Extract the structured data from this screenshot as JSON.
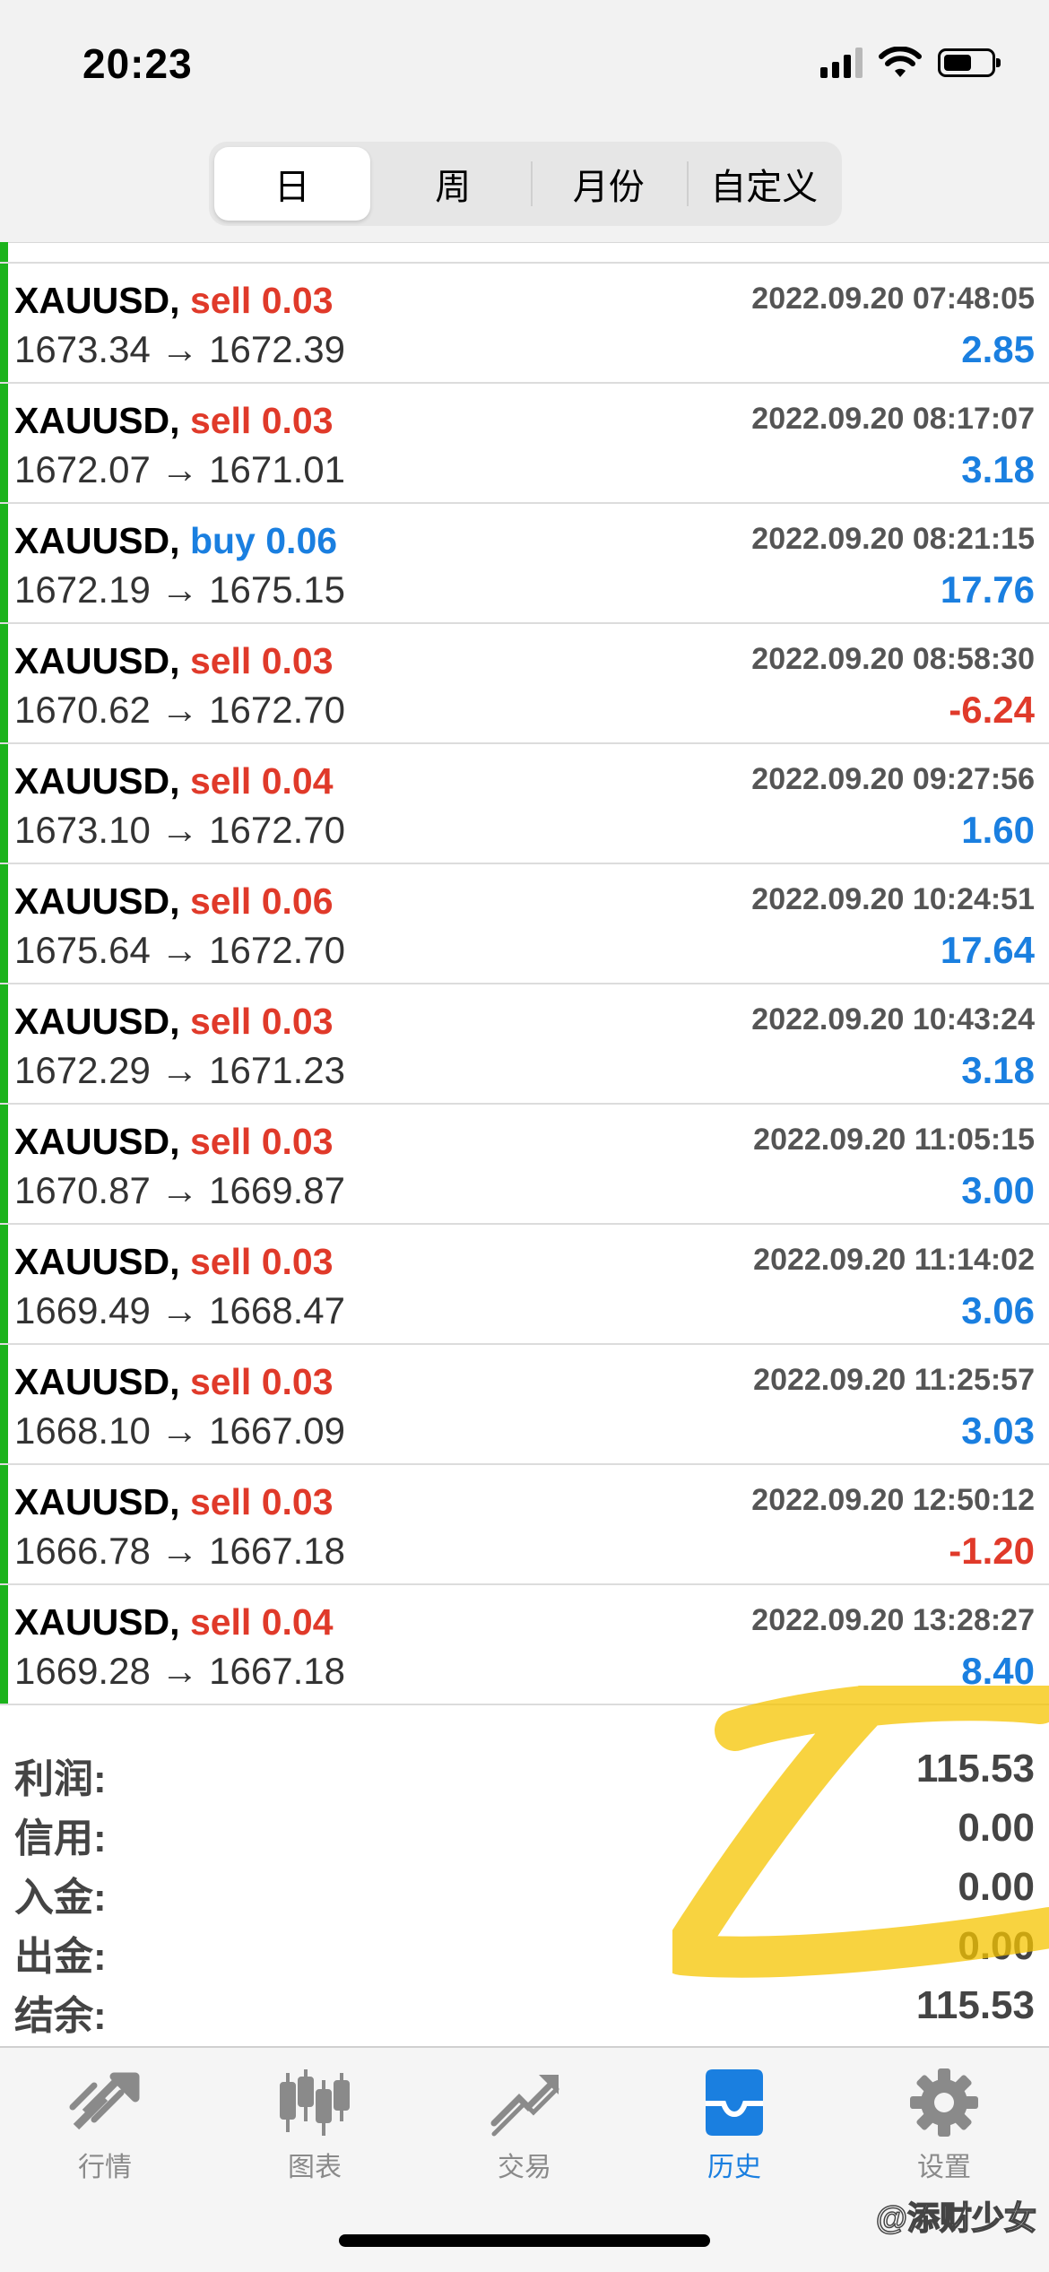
{
  "status_bar": {
    "time": "20:23"
  },
  "segments": [
    "日",
    "周",
    "月份",
    "自定义"
  ],
  "active_segment": "日",
  "deals": [
    {
      "symbol": "XAUUSD,",
      "side": "sell",
      "volume": "0.03",
      "time": "2022.09.20 07:48:05",
      "prices": "1673.34 → 1672.39",
      "profit": "2.85",
      "sign": "pos"
    },
    {
      "symbol": "XAUUSD,",
      "side": "sell",
      "volume": "0.03",
      "time": "2022.09.20 08:17:07",
      "prices": "1672.07 → 1671.01",
      "profit": "3.18",
      "sign": "pos"
    },
    {
      "symbol": "XAUUSD,",
      "side": "buy",
      "volume": "0.06",
      "time": "2022.09.20 08:21:15",
      "prices": "1672.19 → 1675.15",
      "profit": "17.76",
      "sign": "pos"
    },
    {
      "symbol": "XAUUSD,",
      "side": "sell",
      "volume": "0.03",
      "time": "2022.09.20 08:58:30",
      "prices": "1670.62 → 1672.70",
      "profit": "-6.24",
      "sign": "neg"
    },
    {
      "symbol": "XAUUSD,",
      "side": "sell",
      "volume": "0.04",
      "time": "2022.09.20 09:27:56",
      "prices": "1673.10 → 1672.70",
      "profit": "1.60",
      "sign": "pos"
    },
    {
      "symbol": "XAUUSD,",
      "side": "sell",
      "volume": "0.06",
      "time": "2022.09.20 10:24:51",
      "prices": "1675.64 → 1672.70",
      "profit": "17.64",
      "sign": "pos"
    },
    {
      "symbol": "XAUUSD,",
      "side": "sell",
      "volume": "0.03",
      "time": "2022.09.20 10:43:24",
      "prices": "1672.29 → 1671.23",
      "profit": "3.18",
      "sign": "pos"
    },
    {
      "symbol": "XAUUSD,",
      "side": "sell",
      "volume": "0.03",
      "time": "2022.09.20 11:05:15",
      "prices": "1670.87 → 1669.87",
      "profit": "3.00",
      "sign": "pos"
    },
    {
      "symbol": "XAUUSD,",
      "side": "sell",
      "volume": "0.03",
      "time": "2022.09.20 11:14:02",
      "prices": "1669.49 → 1668.47",
      "profit": "3.06",
      "sign": "pos"
    },
    {
      "symbol": "XAUUSD,",
      "side": "sell",
      "volume": "0.03",
      "time": "2022.09.20 11:25:57",
      "prices": "1668.10 → 1667.09",
      "profit": "3.03",
      "sign": "pos"
    },
    {
      "symbol": "XAUUSD,",
      "side": "sell",
      "volume": "0.03",
      "time": "2022.09.20 12:50:12",
      "prices": "1666.78 → 1667.18",
      "profit": "-1.20",
      "sign": "neg"
    },
    {
      "symbol": "XAUUSD,",
      "side": "sell",
      "volume": "0.04",
      "time": "2022.09.20 13:28:27",
      "prices": "1669.28 → 1667.18",
      "profit": "8.40",
      "sign": "pos"
    }
  ],
  "summary": [
    {
      "label": "利润:",
      "value": "115.53"
    },
    {
      "label": "信用:",
      "value": "0.00"
    },
    {
      "label": "入金:",
      "value": "0.00"
    },
    {
      "label": "出金:",
      "value": "0.00"
    },
    {
      "label": "结余:",
      "value": "115.53"
    }
  ],
  "tabs": [
    {
      "label": "行情",
      "icon": "quotes-icon"
    },
    {
      "label": "图表",
      "icon": "chart-icon"
    },
    {
      "label": "交易",
      "icon": "trade-icon"
    },
    {
      "label": "历史",
      "icon": "history-icon"
    },
    {
      "label": "设置",
      "icon": "settings-icon"
    }
  ],
  "active_tab": "历史",
  "watermark": "@添财少女",
  "colors": {
    "sell": "#e03a2a",
    "buy": "#1a7fe0",
    "profit_positive": "#1a7fe0",
    "profit_negative": "#e03a2a",
    "accent": "#1a7fe0",
    "row_marker": "#1bb31b"
  }
}
